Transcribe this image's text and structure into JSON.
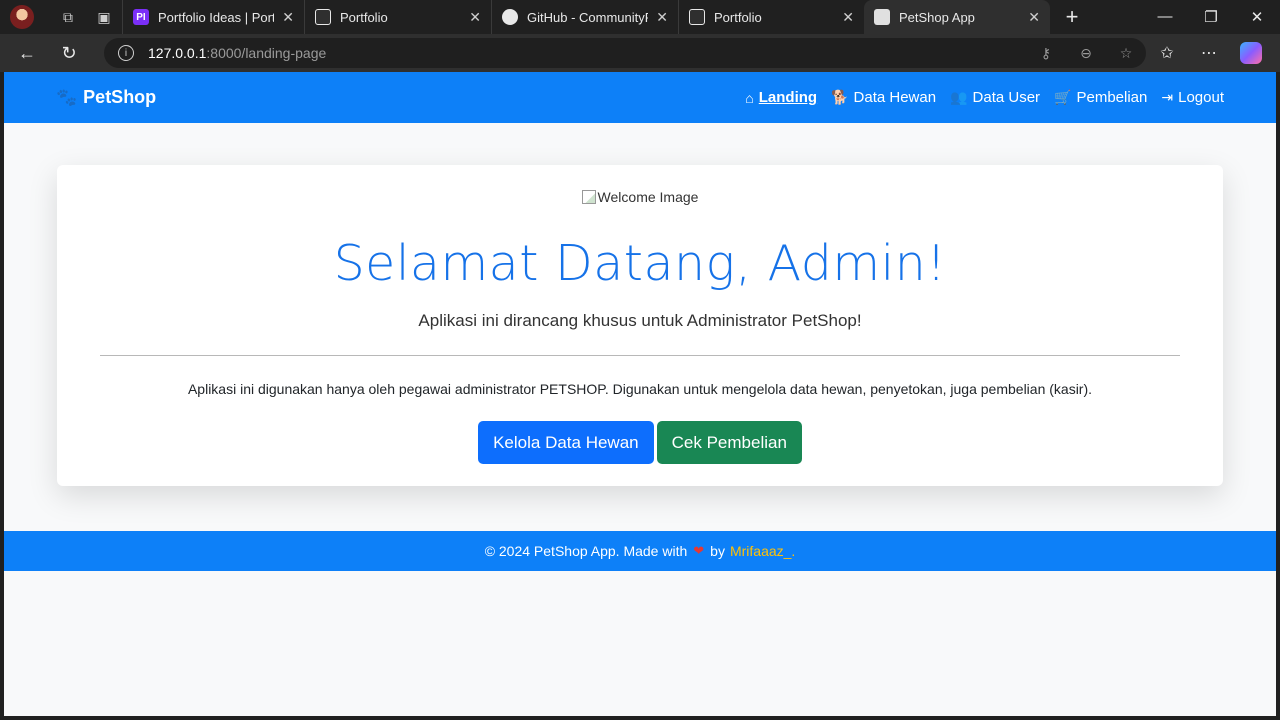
{
  "browser": {
    "tabs": [
      {
        "title": "Portfolio Ideas | Portfolio",
        "favicon_color": "#7b2ff7",
        "favicon_text": "PI"
      },
      {
        "title": "Portfolio",
        "favicon_color": "#2f2f2f",
        "favicon_text": ""
      },
      {
        "title": "GitHub - CommunityPro",
        "favicon_color": "#2f2f2f",
        "favicon_text": ""
      },
      {
        "title": "Portfolio",
        "favicon_color": "#2f2f2f",
        "favicon_text": ""
      },
      {
        "title": "PetShop App",
        "favicon_color": "#e0e0e0",
        "favicon_text": "",
        "active": true
      }
    ],
    "url_host": "127.0.0.1",
    "url_path": ":8000/landing-page"
  },
  "navbar": {
    "brand": "PetShop",
    "items": [
      {
        "label": "Landing",
        "icon": "home-icon",
        "active": true
      },
      {
        "label": "Data Hewan",
        "icon": "dog-icon"
      },
      {
        "label": "Data User",
        "icon": "users-icon"
      },
      {
        "label": "Pembelian",
        "icon": "cart-icon"
      },
      {
        "label": "Logout",
        "icon": "logout-icon"
      }
    ]
  },
  "hero": {
    "image_alt": "Welcome Image",
    "title": "Selamat Datang, Admin!",
    "lead": "Aplikasi ini dirancang khusus untuk Administrator PetShop!",
    "description": "Aplikasi ini digunakan hanya oleh pegawai administrator PETSHOP. Digunakan untuk mengelola data hewan, penyetokan, juga pembelian (kasir).",
    "primary_button": "Kelola Data Hewan",
    "secondary_button": "Cek Pembelian"
  },
  "footer": {
    "text_before": "© 2024 PetShop App. Made with",
    "text_by": "by",
    "author": "Mrifaaaz_."
  },
  "colors": {
    "brand_blue": "#0d80f8",
    "primary": "#0d6efd",
    "success": "#198754",
    "author_yellow": "#ffc107"
  }
}
